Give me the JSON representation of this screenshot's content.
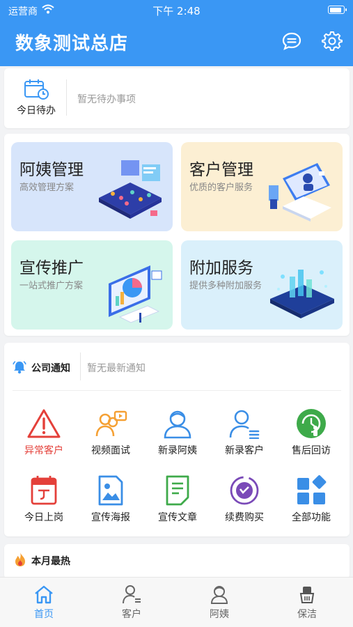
{
  "status_bar": {
    "carrier": "运营商",
    "time": "下午 2:48",
    "battery_level": 0.9
  },
  "header": {
    "title": "数象测试总店",
    "message_icon": "chat-bubble-icon",
    "settings_icon": "gear-icon"
  },
  "todo": {
    "label": "今日待办",
    "empty_text": "暂无待办事项",
    "icon": "calendar-clock-icon"
  },
  "modules": [
    {
      "title": "阿姨管理",
      "subtitle": "高效管理方案",
      "bg": "#d7e5fb"
    },
    {
      "title": "客户管理",
      "subtitle": "优质的客户服务",
      "bg": "#fcefd3"
    },
    {
      "title": "宣传推广",
      "subtitle": "一站式推广方案",
      "bg": "#d5f6ec"
    },
    {
      "title": "附加服务",
      "subtitle": "提供多种附加服务",
      "bg": "#daf0fb"
    }
  ],
  "notice": {
    "title": "公司通知",
    "empty_text": "暂无最新通知",
    "icon": "bell-icon"
  },
  "functions": [
    {
      "label": "异常客户",
      "icon": "warning-icon",
      "color": "#e4403a"
    },
    {
      "label": "视频面试",
      "icon": "video-interview-icon",
      "color": "#f5a033"
    },
    {
      "label": "新录阿姨",
      "icon": "nanny-icon",
      "color": "#3a8ee6"
    },
    {
      "label": "新录客户",
      "icon": "customer-icon",
      "color": "#3a8ee6"
    },
    {
      "label": "售后回访",
      "icon": "after-sales-icon",
      "color": "#3eaa4a"
    },
    {
      "label": "今日上岗",
      "icon": "calendar-icon",
      "color": "#e4403a"
    },
    {
      "label": "宣传海报",
      "icon": "poster-icon",
      "color": "#3a8ee6"
    },
    {
      "label": "宣传文章",
      "icon": "article-icon",
      "color": "#3eaa4a"
    },
    {
      "label": "续费购买",
      "icon": "renew-icon",
      "color": "#7a4ab8"
    },
    {
      "label": "全部功能",
      "icon": "all-functions-icon",
      "color": "#3a8ee6"
    }
  ],
  "hot": {
    "title": "本月最热",
    "icon": "flame-icon"
  },
  "tabs": [
    {
      "label": "首页",
      "icon": "home-icon",
      "active": true
    },
    {
      "label": "客户",
      "icon": "customer-icon",
      "active": false
    },
    {
      "label": "阿姨",
      "icon": "nanny-icon",
      "active": false
    },
    {
      "label": "保洁",
      "icon": "cleaning-icon",
      "active": false
    }
  ],
  "colors": {
    "primary": "#3a97f4",
    "danger": "#e4403a",
    "success": "#3eaa4a",
    "warning": "#f5a033"
  }
}
